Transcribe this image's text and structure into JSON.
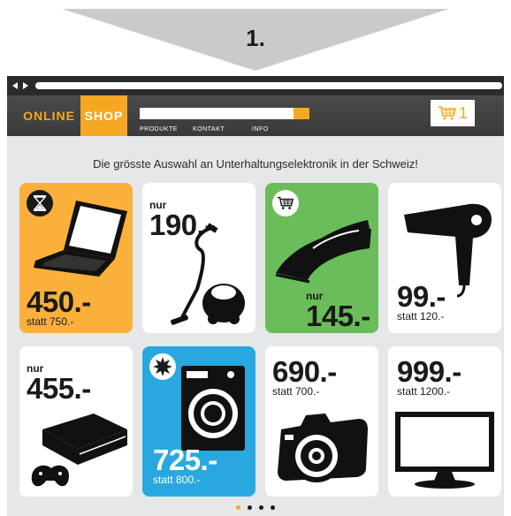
{
  "step": {
    "number": "1."
  },
  "logo": {
    "online": "ONLINE",
    "shop": "SHOP"
  },
  "nav": {
    "items": [
      "PRODUKTE",
      "KONTAKT",
      "INFO"
    ]
  },
  "cart": {
    "count": "1"
  },
  "tagline": "Die grösste Auswahl an Unterhaltungselektronik in der Schweiz!",
  "products": [
    {
      "name": "laptop",
      "price": "450.-",
      "prefix": "",
      "statt": "statt 750.-",
      "color": "#fbb03b",
      "badge": "hourglass-icon"
    },
    {
      "name": "vacuum-cleaner",
      "price": "190.-",
      "prefix": "nur",
      "statt": "",
      "color": "#ffffff",
      "badge": ""
    },
    {
      "name": "iron",
      "price": "145.-",
      "prefix": "nur",
      "statt": "",
      "color": "#6abd5a",
      "badge": "cart-icon"
    },
    {
      "name": "hair-dryer",
      "price": "99.-",
      "prefix": "",
      "statt": "statt 120.-",
      "color": "#ffffff",
      "badge": ""
    },
    {
      "name": "game-console",
      "price": "455.-",
      "prefix": "nur",
      "statt": "",
      "color": "#ffffff",
      "badge": ""
    },
    {
      "name": "washing-machine",
      "price": "725.-",
      "prefix": "",
      "statt": "statt 800.-",
      "color": "#29a8e0",
      "badge": "starburst-icon"
    },
    {
      "name": "camera",
      "price": "690.-",
      "prefix": "",
      "statt": "statt 700.-",
      "color": "#ffffff",
      "badge": ""
    },
    {
      "name": "television",
      "price": "999.-",
      "prefix": "",
      "statt": "statt 1200.-",
      "color": "#ffffff",
      "badge": ""
    }
  ],
  "pagination": {
    "pages": 4,
    "active": 1
  },
  "colors": {
    "accent": "#f7a823",
    "header": "#3d3d3d",
    "background": "#e6e7e8"
  }
}
